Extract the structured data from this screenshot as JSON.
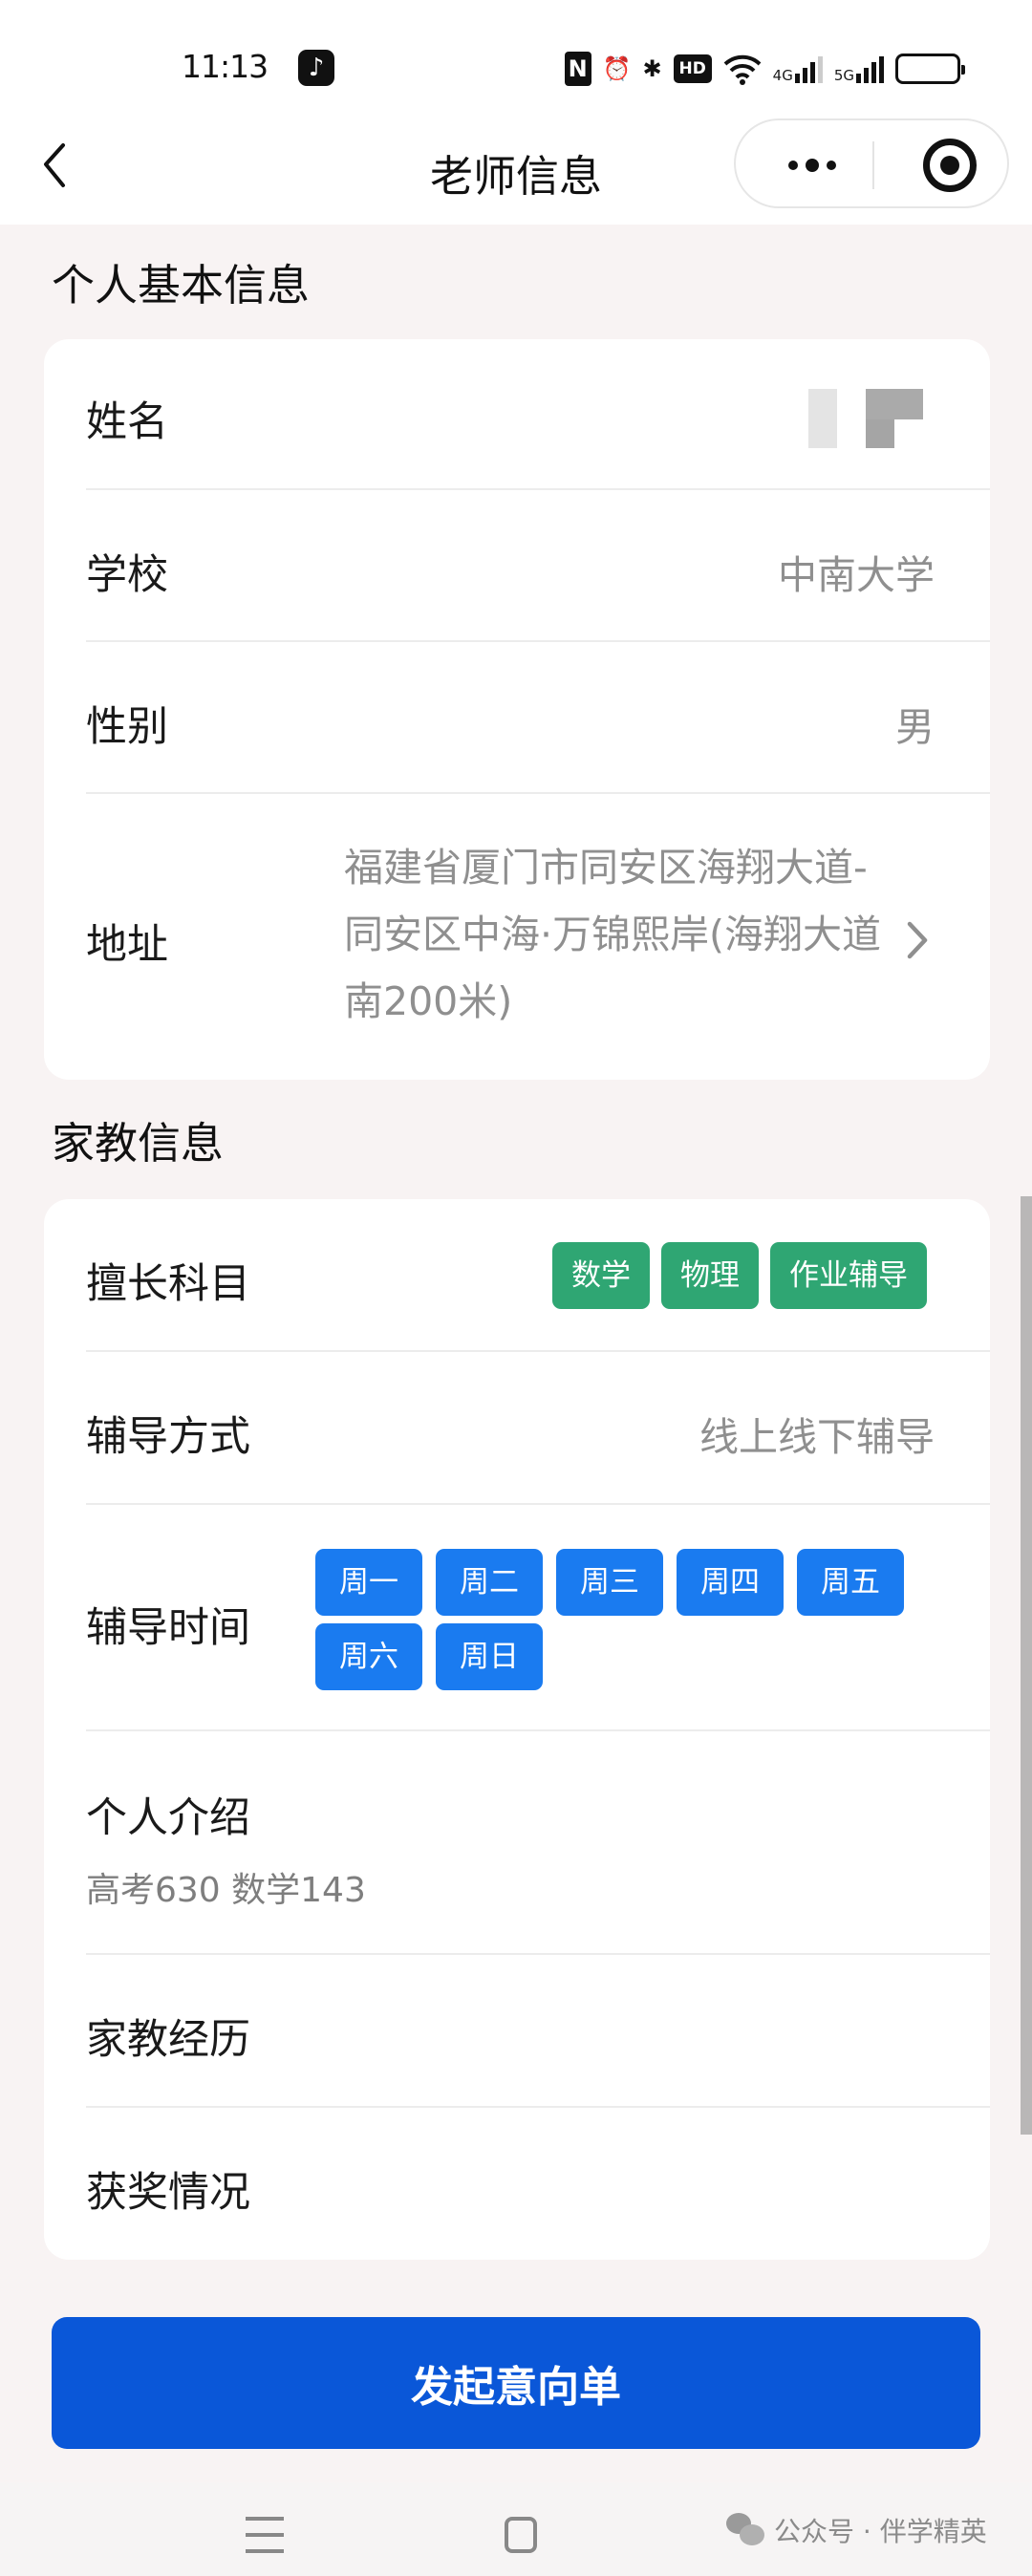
{
  "status_bar": {
    "time": "11:13",
    "app_icon": "tiktok-icon",
    "indicators": [
      "nfc-icon",
      "alarm-icon",
      "bluetooth-icon",
      "hd-voice-icon",
      "wifi-icon",
      "signal-4g-icon",
      "signal-5g-icon",
      "battery-icon"
    ],
    "hd_label": "HD",
    "net1": "4G",
    "net2": "5G",
    "nfc_label": "N",
    "bt_label": "✱",
    "alarm_label": "⏰"
  },
  "nav": {
    "title": "老师信息",
    "back_icon": "chevron-left-icon",
    "more_icon": "more-dots-icon",
    "close_icon": "target-circle-icon"
  },
  "basic_info": {
    "section_title": "个人基本信息",
    "rows": [
      {
        "label": "姓名",
        "value": ""
      },
      {
        "label": "学校",
        "value": "中南大学"
      },
      {
        "label": "性别",
        "value": "男"
      },
      {
        "label": "地址",
        "value": "福建省厦门市同安区海翔大道-同安区中海·万锦熙岸(海翔大道南200米)"
      }
    ]
  },
  "tutor_info": {
    "section_title": "家教信息",
    "subjects_label": "擅长科目",
    "subjects": [
      "数学",
      "物理",
      "作业辅导"
    ],
    "method_label": "辅导方式",
    "method_value": "线上线下辅导",
    "time_label": "辅导时间",
    "days": [
      "周一",
      "周二",
      "周三",
      "周四",
      "周五",
      "周六",
      "周日"
    ],
    "intro_label": "个人介绍",
    "intro_text": "高考630 数学143",
    "experience_label": "家教经历",
    "awards_label": "获奖情况"
  },
  "actions": {
    "submit_label": "发起意向单"
  },
  "system_nav": {
    "watermark": "公众号 · 伴学精英"
  },
  "colors": {
    "subject_tag": "#2fa673",
    "day_tag": "#1a7bf0",
    "primary_button": "#0a57d8",
    "page_background": "#f8f3f3"
  }
}
